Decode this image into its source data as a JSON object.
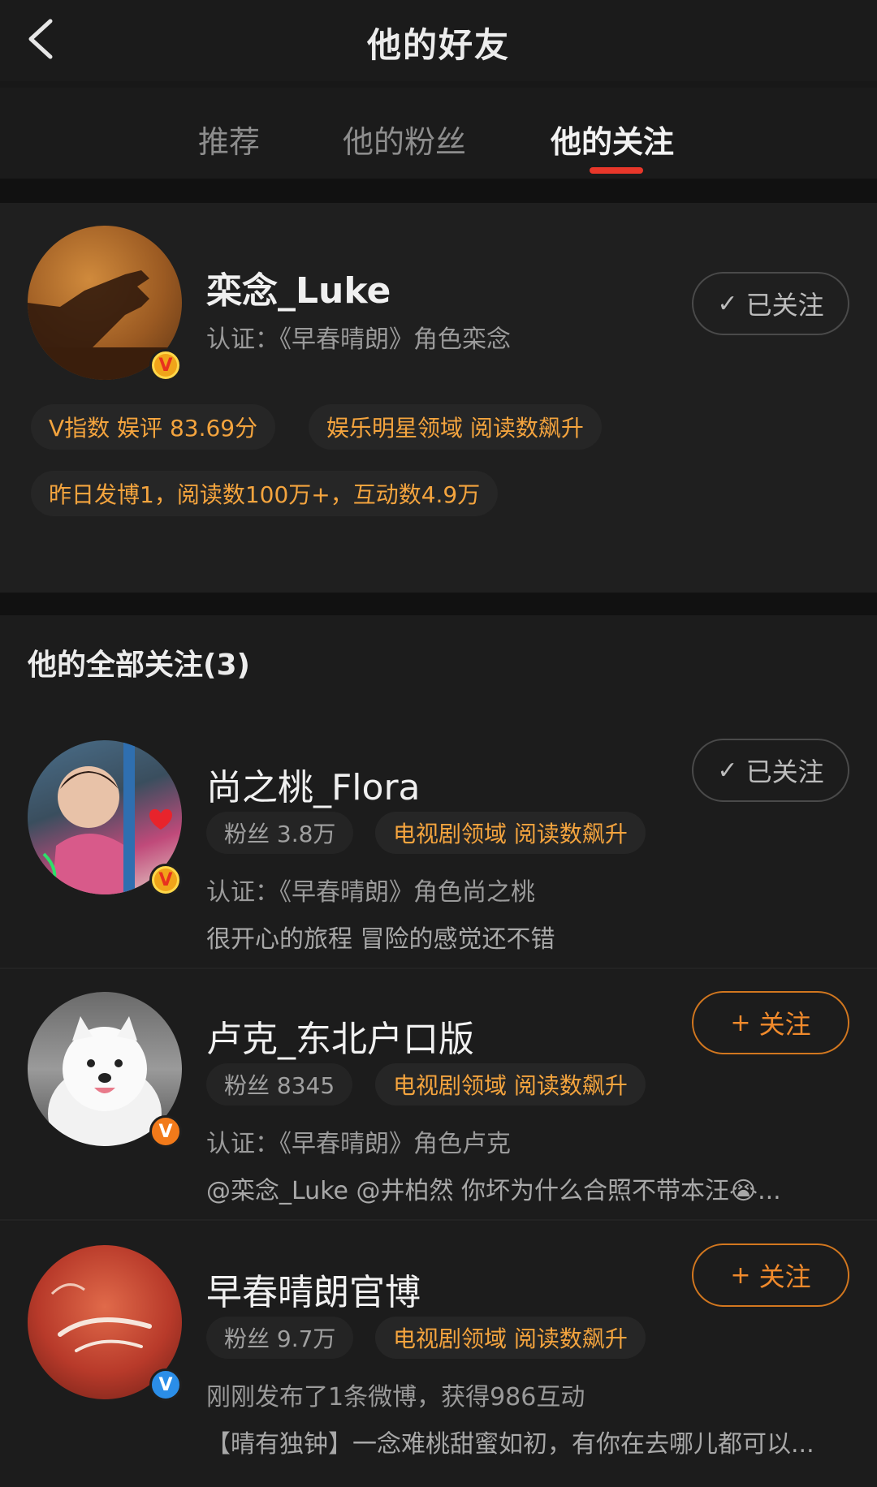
{
  "header": {
    "title": "他的好友"
  },
  "tabs": [
    "推荐",
    "他的粉丝",
    "他的关注"
  ],
  "profile": {
    "name": "栾念_Luke",
    "verification": "认证：《早春晴朗》角色栾念",
    "tags": [
      "V指数 娱评 83.69分",
      "娱乐明星领域 阅读数飙升",
      "昨日发博1，阅读数100万+，互动数4.9万"
    ],
    "follow_label": "已关注",
    "badge": "V"
  },
  "section": {
    "title": "他的全部关注(3)"
  },
  "following": [
    {
      "name": "尚之桃_Flora",
      "fans": "粉丝 3.8万",
      "domain": "电视剧领域 阅读数飙升",
      "verification": "认证：《早春晴朗》角色尚之桃",
      "bio": "很开心的旅程 冒险的感觉还不错",
      "follow_label": "已关注",
      "followed": true,
      "badge": "V"
    },
    {
      "name": "卢克_东北户口版",
      "fans": "粉丝 8345",
      "domain": "电视剧领域 阅读数飙升",
      "verification": "认证：《早春晴朗》角色卢克",
      "bio": "@栾念_Luke @井柏然 你坏为什么合照不带本汪😭...",
      "follow_label": "关注",
      "followed": false,
      "badge": "V"
    },
    {
      "name": "早春晴朗官博",
      "fans": "粉丝 9.7万",
      "domain": "电视剧领域 阅读数飙升",
      "verification": "刚刚发布了1条微博，获得986互动",
      "bio": "【晴有独钟】一念难桃甜蜜如初，有你在去哪儿都可以...",
      "follow_label": "关注",
      "followed": false,
      "badge": "V"
    }
  ],
  "icons": {
    "check": "✓",
    "plus": "+"
  },
  "colors": {
    "accent": "#f08a2c",
    "underline": "#e8372a",
    "tag_text": "#f4a43e"
  }
}
